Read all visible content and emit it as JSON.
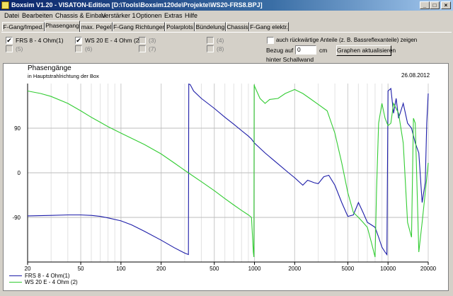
{
  "window": {
    "title": "Boxsim V1.20 - VISATON-Edition [D:\\Tools\\Boxsim120de\\Projekte\\WS20-FRS8.BPJ]"
  },
  "menu": [
    "Datei",
    "Bearbeiten",
    "Chassis & Einbau",
    "Verstärker 1",
    "Optionen",
    "Extras",
    "Hilfe"
  ],
  "tabs": [
    "F-Gang/Imped.",
    "Phasengang",
    "max. Pegel",
    "F-Gang Richtungen",
    "Polarplots",
    "Bündelung",
    "Chassis",
    "F-Gang elektr."
  ],
  "active_tab": "Phasengang",
  "channels": {
    "col1": [
      {
        "label": "FRS 8 - 4 Ohm(1)",
        "checked": "✔"
      },
      {
        "label": "(5)"
      }
    ],
    "col2": [
      {
        "label": "WS 20 E - 4 Ohm  (2)",
        "checked": "✔"
      },
      {
        "label": "(6)"
      }
    ],
    "col3": [
      {
        "label": "(3)"
      },
      {
        "label": "(7)"
      }
    ],
    "col4": [
      {
        "label": "(4)"
      },
      {
        "label": "(8)"
      }
    ]
  },
  "options": {
    "rear_checkbox_label": "auch rückwärtige Anteile (z. B. Bassreflexanteile) zeigen",
    "reference_label_1": "Bezug auf",
    "reference_label_2": "hinter Schallwand",
    "reference_value": "0",
    "reference_unit": "cm",
    "update_button": "Graphen aktualisieren"
  },
  "chart_data": {
    "type": "line",
    "title": "Phasengänge",
    "subtitle": "in Hauptstrahlrichtung der Box",
    "date": "26.08.2012",
    "xscale": "log",
    "xlim": [
      20,
      20000
    ],
    "ylim": [
      -180,
      180
    ],
    "x_ticks": [
      20,
      50,
      100,
      200,
      500,
      1000,
      2000,
      5000,
      10000,
      20000
    ],
    "y_ticks": [
      90,
      0,
      -90
    ],
    "grid": true,
    "legend_position": "bottom-left",
    "series": [
      {
        "name": "FRS 8 - 4 Ohm(1)",
        "color": "#1c1ca8",
        "points": [
          [
            20,
            -87
          ],
          [
            30,
            -86
          ],
          [
            40,
            -85
          ],
          [
            50,
            -85
          ],
          [
            60,
            -86
          ],
          [
            70,
            -88
          ],
          [
            80,
            -91
          ],
          [
            100,
            -97
          ],
          [
            120,
            -105
          ],
          [
            150,
            -118
          ],
          [
            200,
            -136
          ],
          [
            250,
            -151
          ],
          [
            300,
            -162
          ],
          [
            320,
            -165
          ],
          [
            322,
            179
          ],
          [
            330,
            178
          ],
          [
            350,
            165
          ],
          [
            400,
            150
          ],
          [
            500,
            130
          ],
          [
            600,
            112
          ],
          [
            700,
            98
          ],
          [
            800,
            85
          ],
          [
            900,
            74
          ],
          [
            950,
            68
          ],
          [
            1000,
            60
          ],
          [
            1200,
            40
          ],
          [
            1500,
            18
          ],
          [
            1800,
            0
          ],
          [
            2000,
            -10
          ],
          [
            2300,
            -25
          ],
          [
            2500,
            -15
          ],
          [
            2800,
            -20
          ],
          [
            3000,
            -22
          ],
          [
            3300,
            -8
          ],
          [
            3600,
            -5
          ],
          [
            4000,
            -25
          ],
          [
            4500,
            -60
          ],
          [
            5000,
            -88
          ],
          [
            5500,
            -85
          ],
          [
            6000,
            -60
          ],
          [
            6500,
            -80
          ],
          [
            7000,
            -100
          ],
          [
            7500,
            -105
          ],
          [
            8000,
            -110
          ],
          [
            8500,
            -130
          ],
          [
            9000,
            -150
          ],
          [
            9500,
            -160
          ],
          [
            9800,
            -165
          ],
          [
            10000,
            165
          ],
          [
            10500,
            170
          ],
          [
            11000,
            120
          ],
          [
            11500,
            150
          ],
          [
            12000,
            110
          ],
          [
            13000,
            140
          ],
          [
            14000,
            100
          ],
          [
            15000,
            90
          ],
          [
            16000,
            60
          ],
          [
            17000,
            40
          ],
          [
            18000,
            -60
          ],
          [
            19000,
            -20
          ],
          [
            19500,
            100
          ],
          [
            20000,
            160
          ]
        ]
      },
      {
        "name": "WS 20 E - 4 Ohm  (2)",
        "color": "#33cc33",
        "points": [
          [
            20,
            165
          ],
          [
            25,
            160
          ],
          [
            30,
            154
          ],
          [
            40,
            140
          ],
          [
            50,
            125
          ],
          [
            60,
            112
          ],
          [
            70,
            102
          ],
          [
            80,
            93
          ],
          [
            100,
            80
          ],
          [
            150,
            57
          ],
          [
            200,
            38
          ],
          [
            250,
            20
          ],
          [
            300,
            5
          ],
          [
            400,
            -18
          ],
          [
            500,
            -36
          ],
          [
            600,
            -52
          ],
          [
            700,
            -65
          ],
          [
            800,
            -76
          ],
          [
            900,
            -85
          ],
          [
            950,
            -90
          ],
          [
            980,
            -160
          ],
          [
            990,
            -170
          ],
          [
            995,
            178
          ],
          [
            1000,
            175
          ],
          [
            1100,
            150
          ],
          [
            1200,
            140
          ],
          [
            1300,
            148
          ],
          [
            1500,
            150
          ],
          [
            1700,
            160
          ],
          [
            2000,
            168
          ],
          [
            2300,
            160
          ],
          [
            2600,
            150
          ],
          [
            3000,
            138
          ],
          [
            3500,
            125
          ],
          [
            4000,
            80
          ],
          [
            4500,
            20
          ],
          [
            5000,
            -40
          ],
          [
            5500,
            -80
          ],
          [
            6000,
            -90
          ],
          [
            6500,
            -100
          ],
          [
            7000,
            -110
          ],
          [
            7500,
            -140
          ],
          [
            8000,
            -170
          ],
          [
            8200,
            -40
          ],
          [
            8500,
            100
          ],
          [
            9000,
            140
          ],
          [
            9500,
            110
          ],
          [
            10000,
            95
          ],
          [
            10500,
            100
          ],
          [
            11000,
            140
          ],
          [
            12000,
            120
          ],
          [
            13000,
            60
          ],
          [
            14000,
            -100
          ],
          [
            15000,
            -130
          ],
          [
            15500,
            110
          ],
          [
            16000,
            100
          ],
          [
            17000,
            -160
          ],
          [
            18000,
            -100
          ],
          [
            19000,
            -40
          ],
          [
            20000,
            20
          ]
        ]
      }
    ]
  }
}
